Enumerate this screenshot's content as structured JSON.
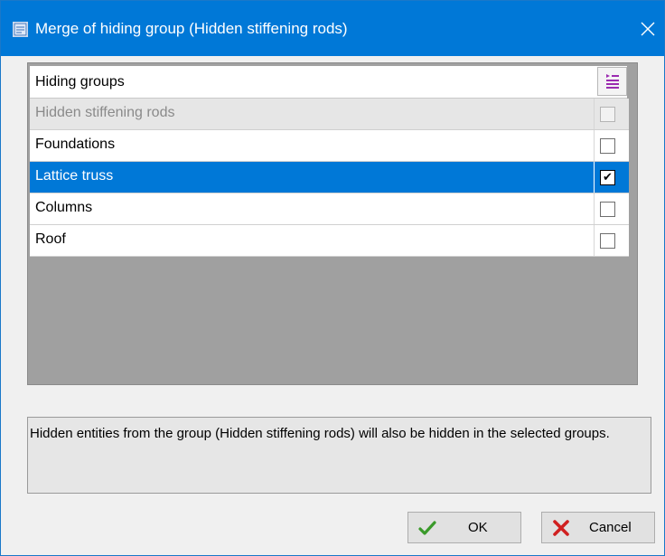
{
  "window": {
    "title": "Merge of hiding group (Hidden stiffening rods)"
  },
  "grid": {
    "header_label": "Hiding groups",
    "rows": [
      {
        "label": "Hidden stiffening rods",
        "checked": false,
        "state": "disabled"
      },
      {
        "label": "Foundations",
        "checked": false,
        "state": "normal"
      },
      {
        "label": "Lattice truss",
        "checked": true,
        "state": "selected"
      },
      {
        "label": "Columns",
        "checked": false,
        "state": "normal"
      },
      {
        "label": "Roof",
        "checked": false,
        "state": "normal"
      }
    ]
  },
  "info": {
    "text": "Hidden entities from the group (Hidden stiffening rods) will also be hidden in the selected groups."
  },
  "buttons": {
    "ok_label": "OK",
    "cancel_label": "Cancel"
  },
  "icons": {
    "app": "app-window-icon",
    "close": "close-icon",
    "header_toggle": "select-all-list-icon",
    "ok": "green-checkmark-icon",
    "cancel": "red-x-icon"
  },
  "colors": {
    "titlebar": "#0078d7",
    "selection": "#0078d7",
    "grid_background": "#a0a0a0",
    "header_icon": "#9b2bb0"
  }
}
